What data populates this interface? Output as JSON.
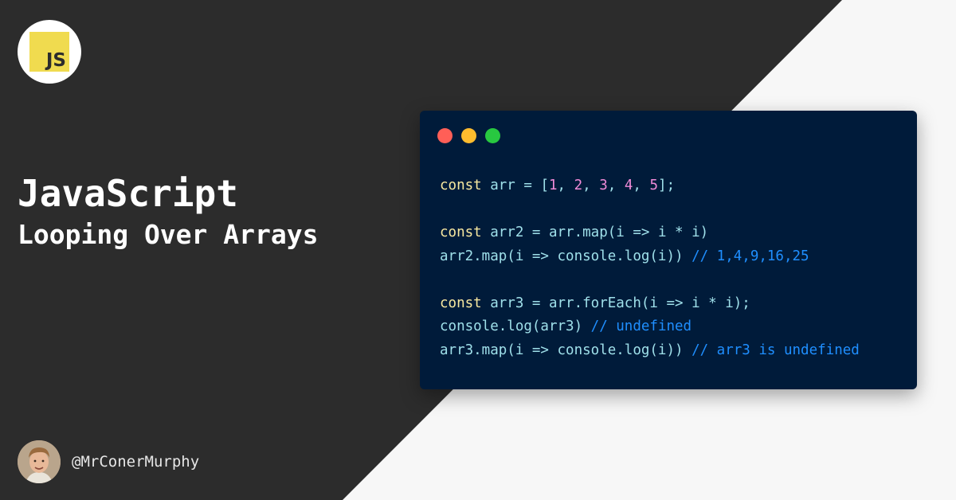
{
  "brand": {
    "logo_text": "JS",
    "logo_color": "#f0db4f"
  },
  "heading": {
    "title": "JavaScript",
    "subtitle": "Looping Over Arrays"
  },
  "author": {
    "handle": "@MrConerMurphy"
  },
  "colors": {
    "dark_bg": "#2c2c2c",
    "light_bg": "#f7f7f7",
    "code_bg": "#001b3a",
    "keyword": "#f8e8a0",
    "number": "#f08bd8",
    "identifier": "#9fe0ea",
    "comment": "#1f8fff"
  },
  "code": {
    "lines": [
      [
        {
          "t": "const",
          "c": "kw"
        },
        {
          "t": " arr = [",
          "c": "id"
        },
        {
          "t": "1",
          "c": "num"
        },
        {
          "t": ", ",
          "c": "id"
        },
        {
          "t": "2",
          "c": "num"
        },
        {
          "t": ", ",
          "c": "id"
        },
        {
          "t": "3",
          "c": "num"
        },
        {
          "t": ", ",
          "c": "id"
        },
        {
          "t": "4",
          "c": "num"
        },
        {
          "t": ", ",
          "c": "id"
        },
        {
          "t": "5",
          "c": "num"
        },
        {
          "t": "];",
          "c": "id"
        }
      ],
      [],
      [
        {
          "t": "const",
          "c": "kw"
        },
        {
          "t": " arr2 = arr.map(i => i * i)",
          "c": "id"
        }
      ],
      [
        {
          "t": "arr2.map(i => console.log(i)) ",
          "c": "id"
        },
        {
          "t": "// 1,4,9,16,25",
          "c": "cm"
        }
      ],
      [],
      [
        {
          "t": "const",
          "c": "kw"
        },
        {
          "t": " arr3 = arr.forEach(i => i * i);",
          "c": "id"
        }
      ],
      [
        {
          "t": "console.log(arr3) ",
          "c": "id"
        },
        {
          "t": "// undefined",
          "c": "cm"
        }
      ],
      [
        {
          "t": "arr3.map(i => console.log(i)) ",
          "c": "id"
        },
        {
          "t": "// arr3 is undefined",
          "c": "cm"
        }
      ]
    ]
  }
}
